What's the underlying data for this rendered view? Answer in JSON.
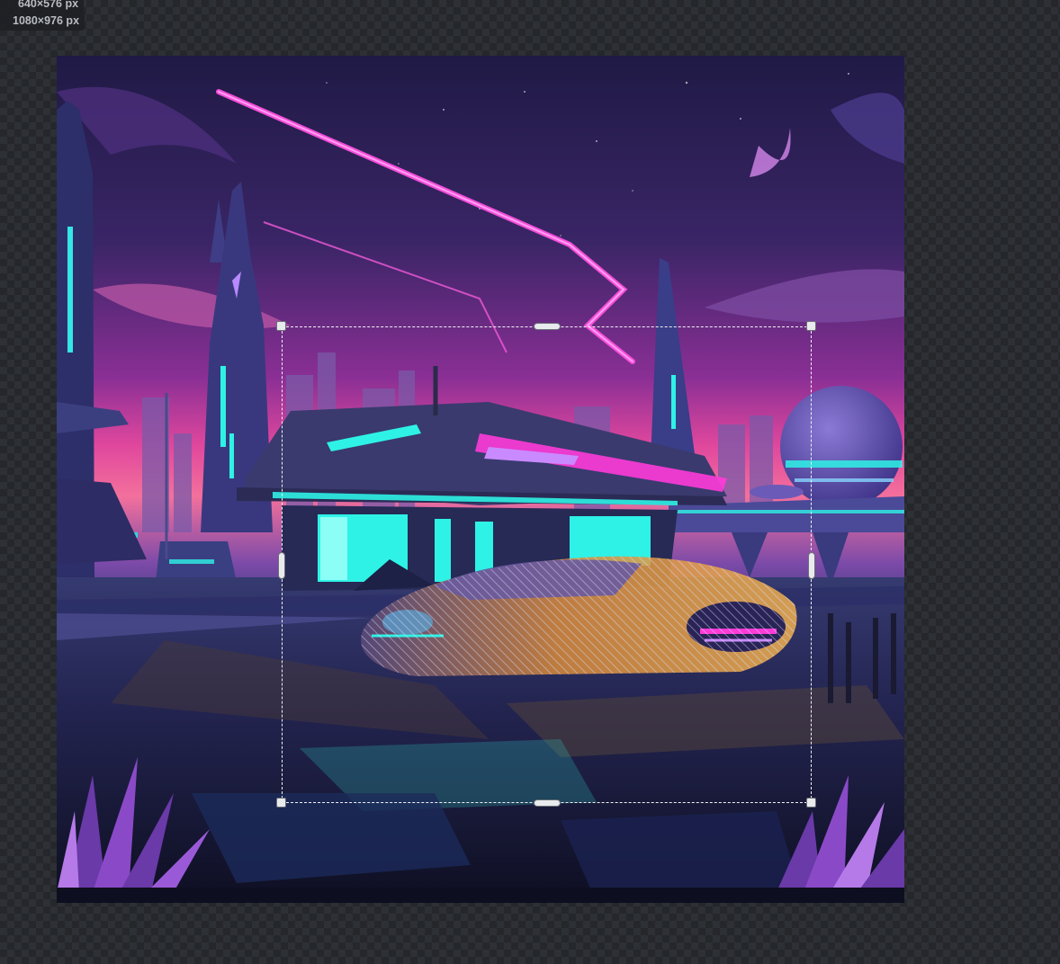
{
  "size_labels": {
    "original": "640×576 px",
    "current": "1080×976 px"
  },
  "colors": {
    "sky_top": "#231c4a",
    "sky_mid": "#7a2e8f",
    "sky_horizon": "#f0539a",
    "neon_pink": "#ff3bd8",
    "neon_cyan": "#2ef2e6",
    "ground": "#1c1d3a",
    "car_orange": "#e8a33a",
    "handle": "#e8eaee"
  }
}
